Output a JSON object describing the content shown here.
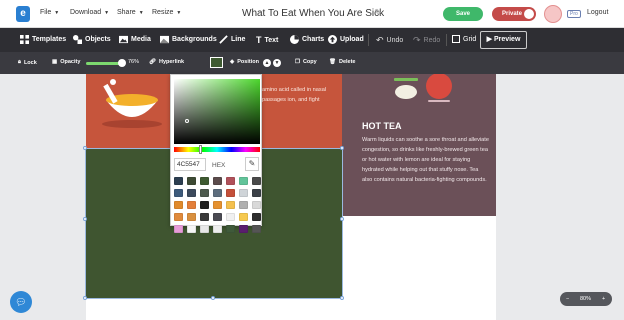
{
  "header": {
    "logo": "e",
    "menus": [
      "File",
      "Download",
      "Share",
      "Resize"
    ],
    "title": "What To Eat When You Are Sick",
    "save": "Save",
    "private": "Private",
    "pro": "Pro",
    "logout": "Logout"
  },
  "toolbar": {
    "templates": "Templates",
    "objects": "Objects",
    "media": "Media",
    "backgrounds": "Backgrounds",
    "line": "Line",
    "text": "Text",
    "charts": "Charts",
    "upload": "Upload",
    "undo": "Undo",
    "redo": "Redo",
    "grid": "Grid",
    "preview": "Preview"
  },
  "subtoolbar": {
    "lock": "Lock",
    "opacity": "Opacity",
    "opacity_value": "76%",
    "hyperlink": "Hyperlink",
    "position": "Position",
    "copy": "Copy",
    "delete": "Delete",
    "fill_color": "#3e5a31"
  },
  "color_picker": {
    "hex_value": "4C5547",
    "format": "HEX",
    "swatches": [
      "#2c3e50",
      "#3d4a34",
      "#3e5a31",
      "#5b4b4b",
      "#b0515a",
      "#62c49a",
      "#4a4a4a",
      "#3d5a7a",
      "#3c4a5c",
      "#4d5a4d",
      "#5d6d7d",
      "#c4503a",
      "#cfd4d8",
      "#3b4047",
      "#e08a2c",
      "#e37f3a",
      "#1f1f1f",
      "#e5912f",
      "#f4c04e",
      "#b0b0b0",
      "#d9d9d9",
      "#e08a3c",
      "#d9903f",
      "#3a3a3a",
      "#4a4a52",
      "#f0f0f0",
      "#f6c94f",
      "#2e2e2e",
      "#e79bd8",
      "#f5f5f5",
      "#e8e8e8",
      "#eeeeee",
      "#3f5a3a",
      "#5a1e6e",
      "#555555"
    ]
  },
  "canvas": {
    "soup_text": "amino acid called in nasal passages ion, and fight",
    "tea_title": "HOT TEA",
    "tea_text": "Warm liquids can soothe a sore throat and alleviate congestion, so drinks like freshly-brewed green tea or hot water with lemon are ideal for staying hydrated while helping out that stuffy nose. Tea also contains natural bacteria-fighting compounds."
  },
  "zoom": {
    "minus": "−",
    "value": "80%",
    "plus": "+"
  },
  "colors": {
    "soup_panel": "#c6553c",
    "green_panel": "#3f5530",
    "tea_panel": "#6b5058",
    "accent_save": "#3fb86a",
    "accent_private": "#c44b49"
  }
}
